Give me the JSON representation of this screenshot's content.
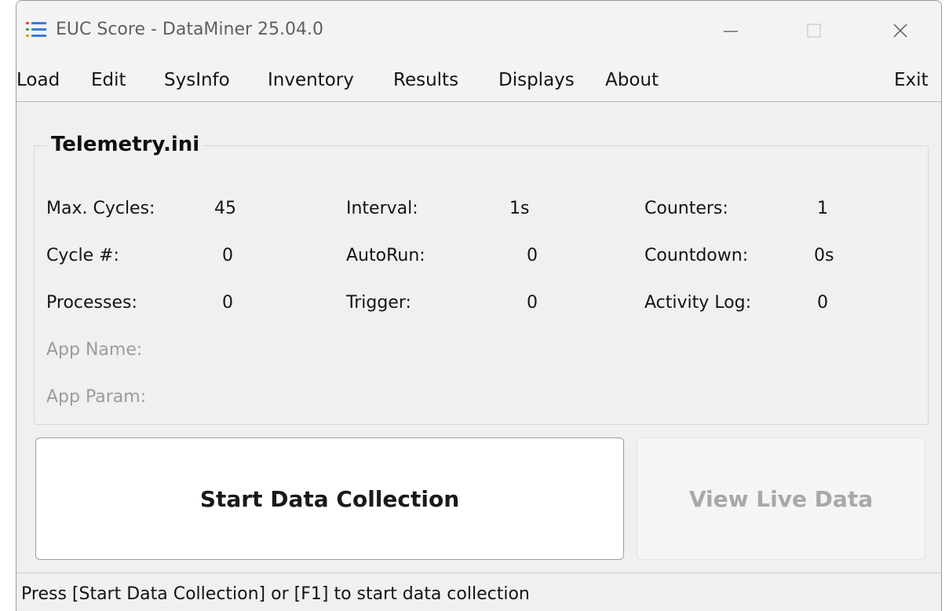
{
  "window": {
    "title": "EUC Score - DataMiner 25.04.0",
    "icon": "list-icon",
    "accent_colors": [
      "#d9534f",
      "#3cae3c",
      "#3b7bd8"
    ]
  },
  "menu": {
    "load": "Load",
    "edit": "Edit",
    "sysinfo": "SysInfo",
    "inventory": "Inventory",
    "results": "Results",
    "displays": "Displays",
    "about": "About",
    "exit": "Exit"
  },
  "group": {
    "title": "Telemetry.ini",
    "fields": {
      "max_cycles": {
        "label": "Max. Cycles:",
        "value": "45"
      },
      "cycle_num": {
        "label": "Cycle #:",
        "value": "0"
      },
      "processes": {
        "label": "Processes:",
        "value": "0"
      },
      "interval": {
        "label": "Interval:",
        "value": "1s"
      },
      "autorun": {
        "label": "AutoRun:",
        "value": "0"
      },
      "trigger": {
        "label": "Trigger:",
        "value": "0"
      },
      "counters": {
        "label": "Counters:",
        "value": "1"
      },
      "countdown": {
        "label": "Countdown:",
        "value": "0s"
      },
      "activity_log": {
        "label": "Activity Log:",
        "value": "0"
      },
      "app_name": {
        "label": "App Name:"
      },
      "app_param": {
        "label": "App Param:"
      }
    }
  },
  "buttons": {
    "start": "Start Data Collection",
    "live": "View Live Data"
  },
  "status": {
    "text": "Press [Start Data Collection] or [F1] to start data collection"
  }
}
